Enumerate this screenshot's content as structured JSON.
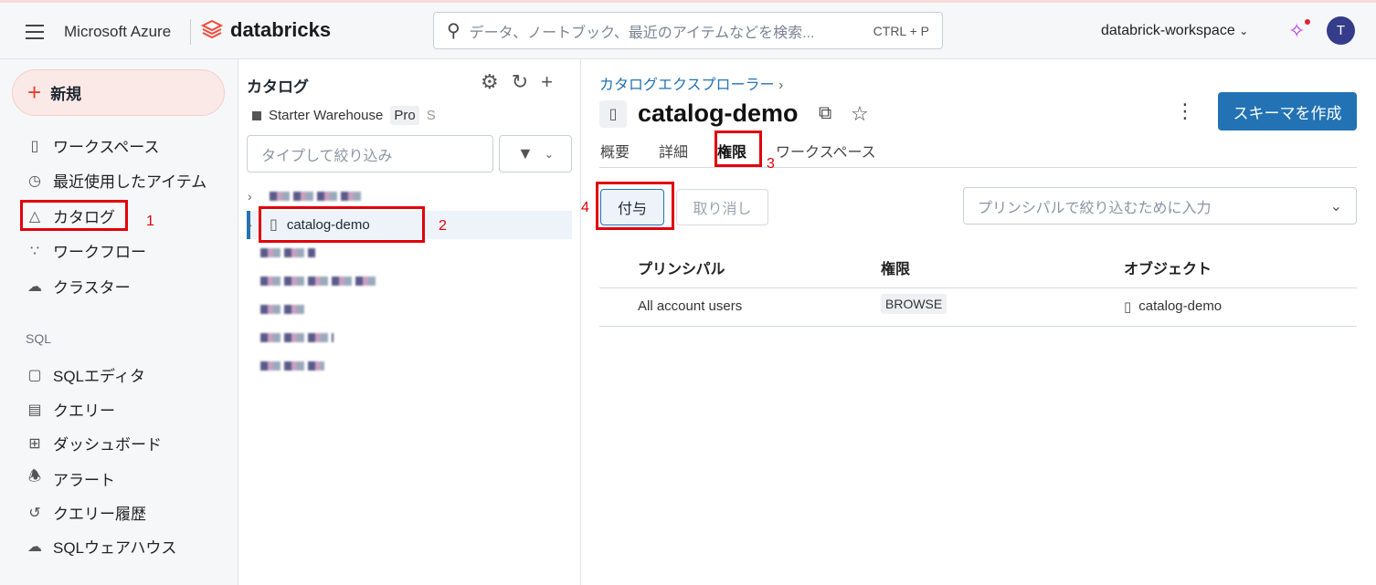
{
  "header": {
    "brand": "Microsoft Azure",
    "product": "databricks",
    "search_placeholder": "データ、ノートブック、最近のアイテムなどを検索...",
    "search_shortcut": "CTRL + P",
    "workspace": "databrick-workspace",
    "avatar_initial": "T"
  },
  "sidebar": {
    "new_label": "新規",
    "items": [
      {
        "label": "ワークスペース",
        "icon": "notebook-icon"
      },
      {
        "label": "最近使用したアイテム",
        "icon": "clock-icon"
      },
      {
        "label": "カタログ",
        "icon": "catalog-icon"
      },
      {
        "label": "ワークフロー",
        "icon": "workflow-icon"
      },
      {
        "label": "クラスター",
        "icon": "cloud-icon"
      }
    ],
    "sql_heading": "SQL",
    "sql_items": [
      {
        "label": "SQLエディタ",
        "icon": "terminal-icon"
      },
      {
        "label": "クエリー",
        "icon": "query-icon"
      },
      {
        "label": "ダッシュボード",
        "icon": "dashboard-icon"
      },
      {
        "label": "アラート",
        "icon": "bell-icon"
      },
      {
        "label": "クエリー履歴",
        "icon": "history-icon"
      },
      {
        "label": "SQLウェアハウス",
        "icon": "warehouse-icon"
      }
    ]
  },
  "catalog_pane": {
    "title": "カタログ",
    "warehouse": "Starter Warehouse",
    "warehouse_tier": "Pro",
    "warehouse_size": "S",
    "filter_placeholder": "タイプして絞り込み",
    "selected_catalog": "catalog-demo"
  },
  "main": {
    "breadcrumb": "カタログエクスプローラー",
    "title": "catalog-demo",
    "create_schema": "スキーマを作成",
    "tabs": [
      "概要",
      "詳細",
      "権限",
      "ワークスペース"
    ],
    "active_tab": "権限",
    "grant": "付与",
    "revoke": "取り消し",
    "principal_filter_placeholder": "プリンシパルで絞り込むために入力",
    "columns": [
      "プリンシパル",
      "権限",
      "オブジェクト"
    ],
    "rows": [
      {
        "principal": "All account users",
        "privilege": "BROWSE",
        "object": "catalog-demo"
      }
    ]
  },
  "annotations": [
    "1",
    "2",
    "3",
    "4"
  ],
  "colors": {
    "accent": "#2272b4",
    "annotation": "#e0000b",
    "new_button": "#fbe9e7"
  }
}
